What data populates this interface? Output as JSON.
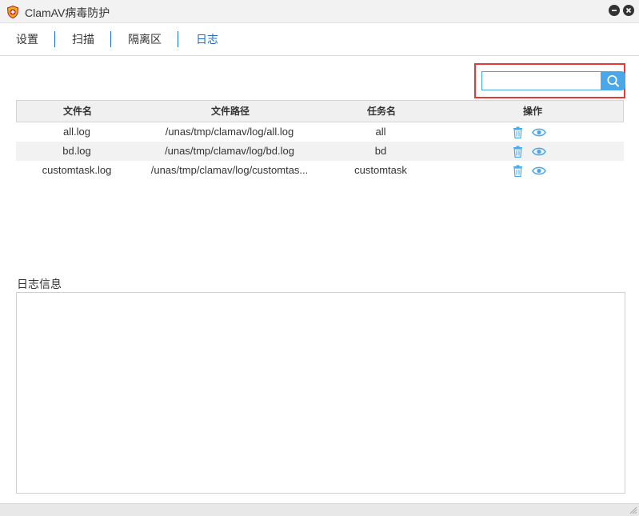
{
  "window": {
    "title": "ClamAV病毒防护"
  },
  "nav": {
    "tabs": [
      {
        "label": "设置",
        "active": false
      },
      {
        "label": "扫描",
        "active": false
      },
      {
        "label": "隔离区",
        "active": false
      },
      {
        "label": "日志",
        "active": true
      }
    ]
  },
  "search": {
    "value": "",
    "placeholder": "",
    "icon": "search-icon"
  },
  "table": {
    "headers": [
      "文件名",
      "文件路径",
      "任务名",
      "操作"
    ],
    "rows": [
      {
        "file": "all.log",
        "path": "/unas/tmp/clamav/log/all.log",
        "task": "all"
      },
      {
        "file": "bd.log",
        "path": "/unas/tmp/clamav/log/bd.log",
        "task": "bd"
      },
      {
        "file": "customtask.log",
        "path": "/unas/tmp/clamav/log/customtas...",
        "task": "customtask"
      }
    ],
    "action_icons": [
      "trash-icon",
      "eye-icon"
    ]
  },
  "log": {
    "label": "日志信息",
    "content": ""
  },
  "colors": {
    "accent": "#1e6fc2",
    "icon": "#4aa8e8",
    "highlight": "#e53935"
  }
}
